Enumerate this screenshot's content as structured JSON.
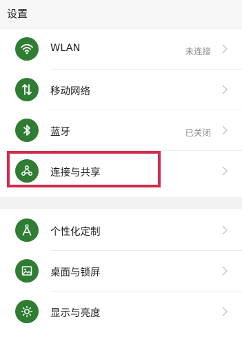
{
  "header": {
    "title": "设置"
  },
  "group1": {
    "items": [
      {
        "label": "WLAN",
        "status": "未连接",
        "icon": "wifi-icon"
      },
      {
        "label": "移动网络",
        "status": "",
        "icon": "mobile-data-icon"
      },
      {
        "label": "蓝牙",
        "status": "已关闭",
        "icon": "bluetooth-icon"
      },
      {
        "label": "连接与共享",
        "status": "",
        "icon": "share-icon",
        "highlighted": true
      }
    ]
  },
  "group2": {
    "items": [
      {
        "label": "个性化定制",
        "status": "",
        "icon": "compass-icon"
      },
      {
        "label": "桌面与锁屏",
        "status": "",
        "icon": "picture-icon"
      },
      {
        "label": "显示与亮度",
        "status": "",
        "icon": "brightness-icon"
      }
    ]
  },
  "colors": {
    "icon_background": "#2e7d32",
    "highlight_border": "#d42a4b",
    "status_text": "#8a8a8a",
    "page_background": "#f2f2f2"
  }
}
